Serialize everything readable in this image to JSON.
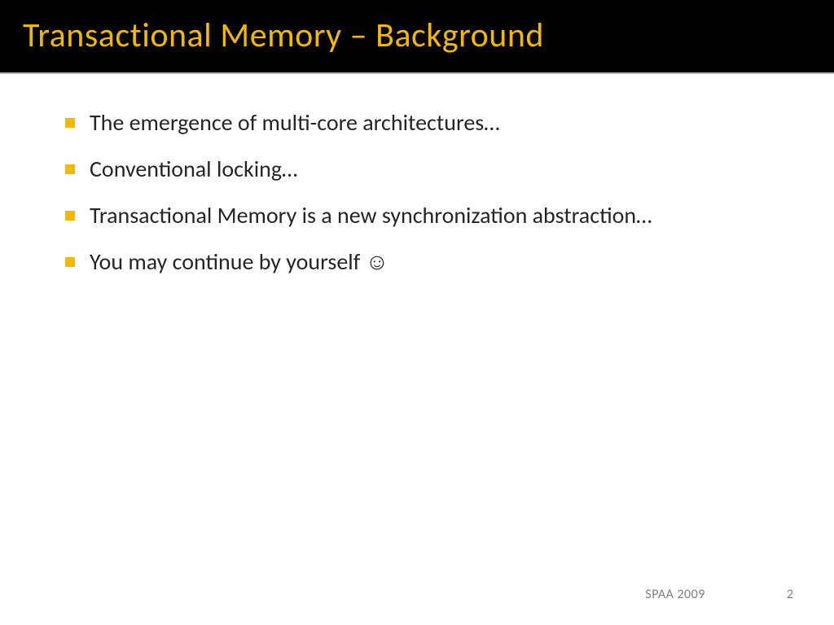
{
  "slide": {
    "title": "Transactional Memory – Background",
    "bullets": [
      "The emergence of multi-core architectures…",
      "Conventional locking…",
      "Transactional Memory is a new synchronization abstraction…",
      "You may continue by yourself ☺"
    ],
    "footer": {
      "label": "SPAA 2009",
      "page_number": "2"
    }
  }
}
